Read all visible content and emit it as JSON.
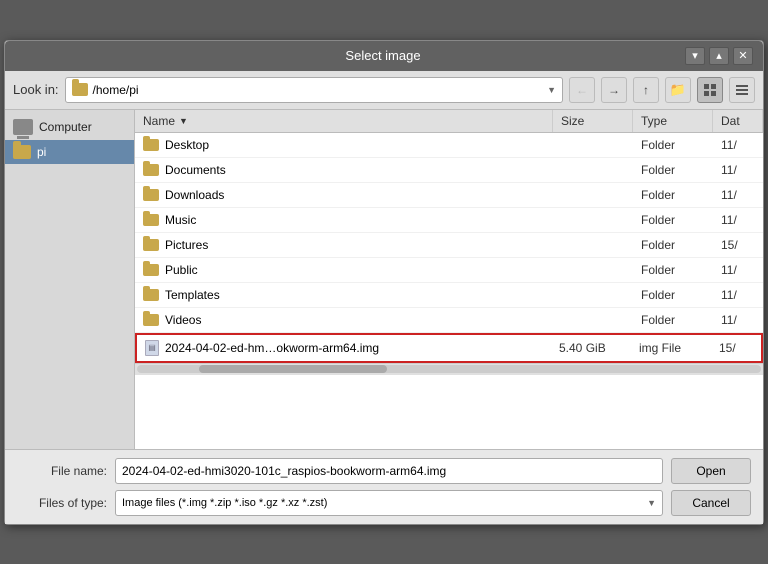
{
  "dialog": {
    "title": "Select image",
    "title_controls": {
      "minimize": "▾",
      "maximize": "▴",
      "close": "✕"
    }
  },
  "toolbar": {
    "look_in_label": "Look in:",
    "look_in_path": "/home/pi",
    "btn_back": "←",
    "btn_forward": "→",
    "btn_up": "↑",
    "btn_new_folder": "📁",
    "btn_grid_view": "⊞",
    "btn_list_view": "≡"
  },
  "sidebar": {
    "items": [
      {
        "id": "computer",
        "label": "Computer",
        "icon": "computer"
      },
      {
        "id": "pi",
        "label": "pi",
        "icon": "folder",
        "selected": true
      }
    ]
  },
  "file_list": {
    "columns": [
      {
        "id": "name",
        "label": "Name"
      },
      {
        "id": "size",
        "label": "Size"
      },
      {
        "id": "type",
        "label": "Type"
      },
      {
        "id": "date",
        "label": "Dat"
      }
    ],
    "rows": [
      {
        "name": "Desktop",
        "size": "",
        "type": "Folder",
        "date": "11/",
        "icon": "folder",
        "selected": false
      },
      {
        "name": "Documents",
        "size": "",
        "type": "Folder",
        "date": "11/",
        "icon": "folder",
        "selected": false
      },
      {
        "name": "Downloads",
        "size": "",
        "type": "Folder",
        "date": "11/",
        "icon": "folder",
        "selected": false
      },
      {
        "name": "Music",
        "size": "",
        "type": "Folder",
        "date": "11/",
        "icon": "folder",
        "selected": false
      },
      {
        "name": "Pictures",
        "size": "",
        "type": "Folder",
        "date": "15/",
        "icon": "folder",
        "selected": false
      },
      {
        "name": "Public",
        "size": "",
        "type": "Folder",
        "date": "11/",
        "icon": "folder",
        "selected": false
      },
      {
        "name": "Templates",
        "size": "",
        "type": "Folder",
        "date": "11/",
        "icon": "folder",
        "selected": false
      },
      {
        "name": "Videos",
        "size": "",
        "type": "Folder",
        "date": "11/",
        "icon": "folder",
        "selected": false
      },
      {
        "name": "2024-04-02-ed-hm…okworm-arm64.img",
        "size": "5.40 GiB",
        "type": "img File",
        "date": "15/",
        "icon": "file",
        "selected": true
      }
    ]
  },
  "bottom": {
    "file_name_label": "File name:",
    "file_name_value": "2024-04-02-ed-hmi3020-101c_raspios-bookworm-arm64.img",
    "files_of_type_label": "Files of type:",
    "files_of_type_value": "Image files (*.img *.zip *.iso *.gz *.xz *.zst)",
    "btn_open": "Open",
    "btn_cancel": "Cancel"
  }
}
